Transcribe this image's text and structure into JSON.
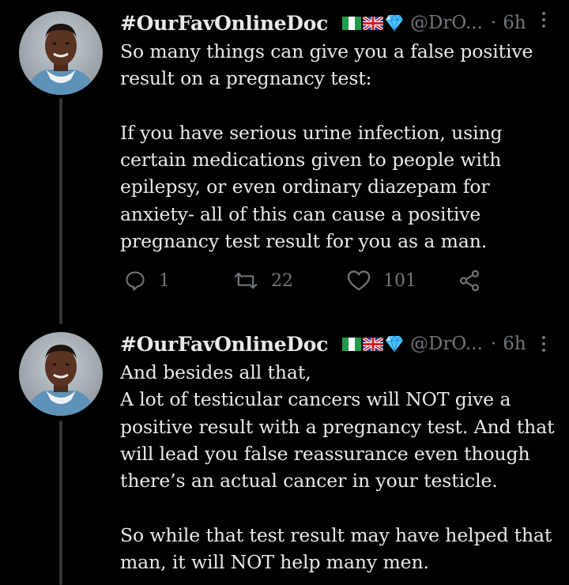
{
  "tweets": [
    {
      "author_name": "#OurFavOnlineDoc",
      "handle": "@DrO...",
      "separator": "·",
      "time": "6h",
      "badges": [
        "nigeria-flag-icon",
        "uk-flag-icon",
        "gem-icon"
      ],
      "text": "So many things can give you a false positive result on a pregnancy test:\n\nIf you have serious urine infection, using certain medications given to people with epilepsy, or even ordinary diazepam for anxiety- all of this can cause a positive pregnancy test result for you as a man.",
      "replies": "1",
      "retweets": "22",
      "likes": "101"
    },
    {
      "author_name": "#OurFavOnlineDoc",
      "handle": "@DrO...",
      "separator": "·",
      "time": "6h",
      "badges": [
        "nigeria-flag-icon",
        "uk-flag-icon",
        "gem-icon"
      ],
      "text": "And besides all that,\nA lot of testicular cancers will NOT give a positive result with a pregnancy test. And that will lead you false reassurance even though there’s an actual cancer in your testicle.\n\nSo while that test result may have helped that man, it will NOT help many men."
    }
  ],
  "colors": {
    "background": "#000000",
    "text": "#e7e9ea",
    "muted": "#71767b",
    "thread_line": "#333639"
  }
}
